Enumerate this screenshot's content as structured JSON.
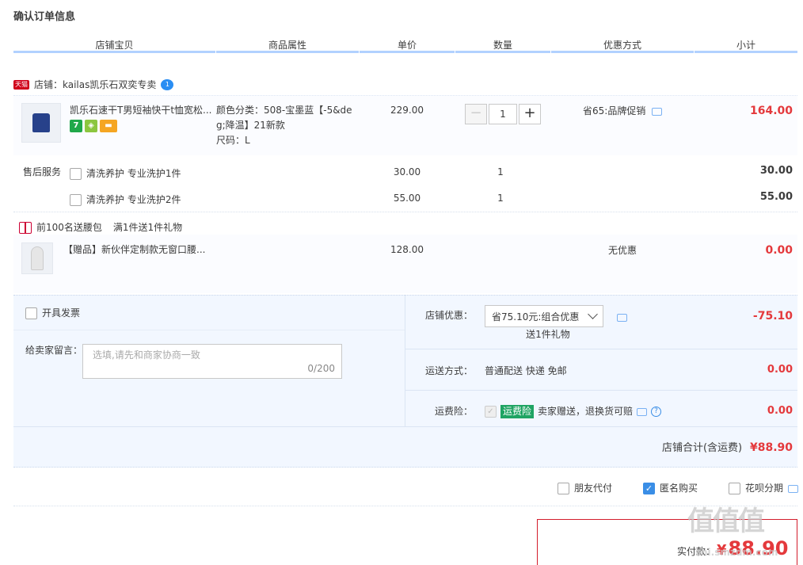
{
  "page_title": "确认订单信息",
  "columns": [
    "店铺宝贝",
    "商品属性",
    "单价",
    "数量",
    "优惠方式",
    "小计"
  ],
  "store": {
    "badge": "天猫",
    "label": "店铺：kailas凯乐石双奕专卖",
    "chat_badge": "1"
  },
  "item": {
    "title": "凯乐石速干T男短袖快干t恤宽松...",
    "badge_seven": "7",
    "attr_line1": "颜色分类：508-宝墨蓝【-5&de",
    "attr_line2": "g;降温】21新款",
    "attr_line3": "尺码：L",
    "unit_price": "229.00",
    "qty_minus": "−",
    "qty_value": "1",
    "qty_plus": "+",
    "discount": "省65:品牌促销",
    "subtotal": "164.00"
  },
  "after_sales": {
    "label": "售后服务",
    "options": [
      {
        "name": "清洗养护 专业洗护1件",
        "price": "30.00",
        "qty": "1",
        "subtotal": "30.00"
      },
      {
        "name": "清洗养护 专业洗护2件",
        "price": "55.00",
        "qty": "1",
        "subtotal": "55.00"
      }
    ]
  },
  "gift_promo": {
    "label": "前100名送腰包",
    "rule": "满1件送1件礼物"
  },
  "gift_item": {
    "title": "【赠品】新伙伴定制款无窗口腰...",
    "unit_price": "128.00",
    "discount": "无优惠",
    "subtotal": "0.00"
  },
  "invoice": {
    "label": "开具发票"
  },
  "message": {
    "label": "给卖家留言：",
    "placeholder": "选填,请先和商家协商一致",
    "counter": "0/200"
  },
  "store_discount": {
    "label": "店铺优惠：",
    "selected": "省75.10元:组合优惠",
    "note": "送1件礼物",
    "amount": "-75.10"
  },
  "shipping": {
    "label": "运送方式：",
    "value": "普通配送 快递 免邮",
    "amount": "0.00"
  },
  "insurance": {
    "label": "运费险：",
    "tag": "运费险",
    "desc": "卖家赠送，退换货可赔",
    "amount": "0.00"
  },
  "store_total": {
    "label": "店铺合计(含运费)",
    "amount": "¥88.90"
  },
  "options": {
    "friend_pay": "朋友代付",
    "anonymous": "匿名购买",
    "huabei": "花呗分期"
  },
  "payment": {
    "label": "实付款：",
    "currency": "¥",
    "amount": "88.90"
  },
  "watermark": {
    "main": "值值值",
    "sub": "zhi.smzdm.com"
  },
  "colors": {
    "accent_red": "#e4393c",
    "header_bar": "#b2d1ff",
    "panel_bg": "#f2f7ff",
    "tag_green": "#1fa463"
  }
}
